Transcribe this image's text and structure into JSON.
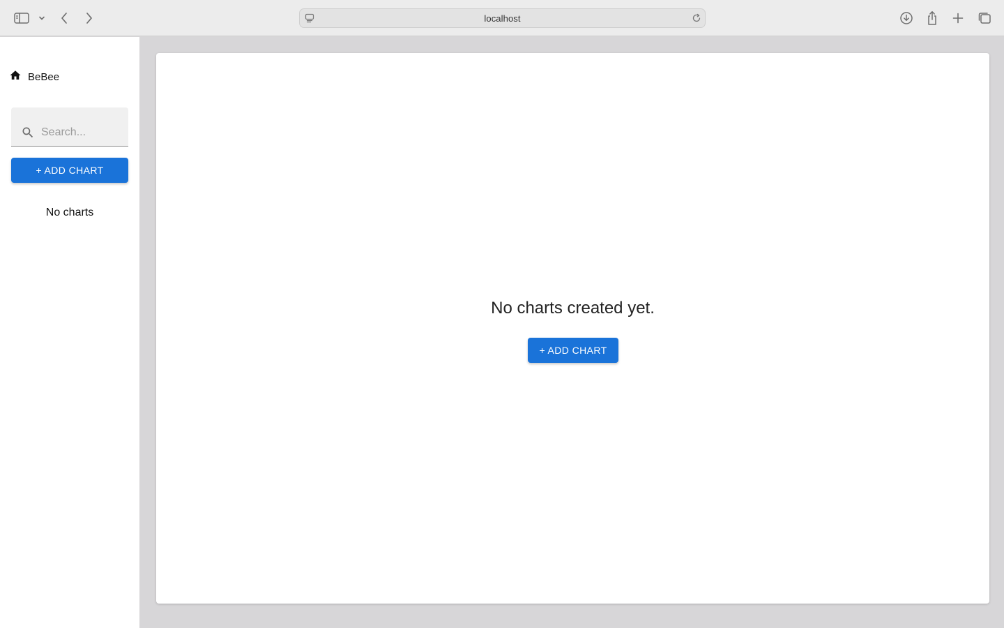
{
  "browser": {
    "url": "localhost",
    "icons": [
      "sidebar-toggle-icon",
      "chevron-down-icon",
      "back-icon",
      "forward-icon",
      "site-settings-icon",
      "reload-icon",
      "download-icon",
      "share-icon",
      "new-tab-icon",
      "tab-overview-icon"
    ]
  },
  "sidebar": {
    "brand": {
      "icon": "home-icon",
      "label": "BeBee"
    },
    "search": {
      "placeholder": "Search...",
      "value": "",
      "icon": "search-icon"
    },
    "add_button_label": "+ ADD CHART",
    "empty_text": "No charts"
  },
  "main": {
    "empty_title": "No charts created yet.",
    "add_button_label": "+ ADD CHART"
  },
  "colors": {
    "accent": "#1a73d9",
    "canvas": "#d7d6d8",
    "toolbar": "#ececec"
  }
}
